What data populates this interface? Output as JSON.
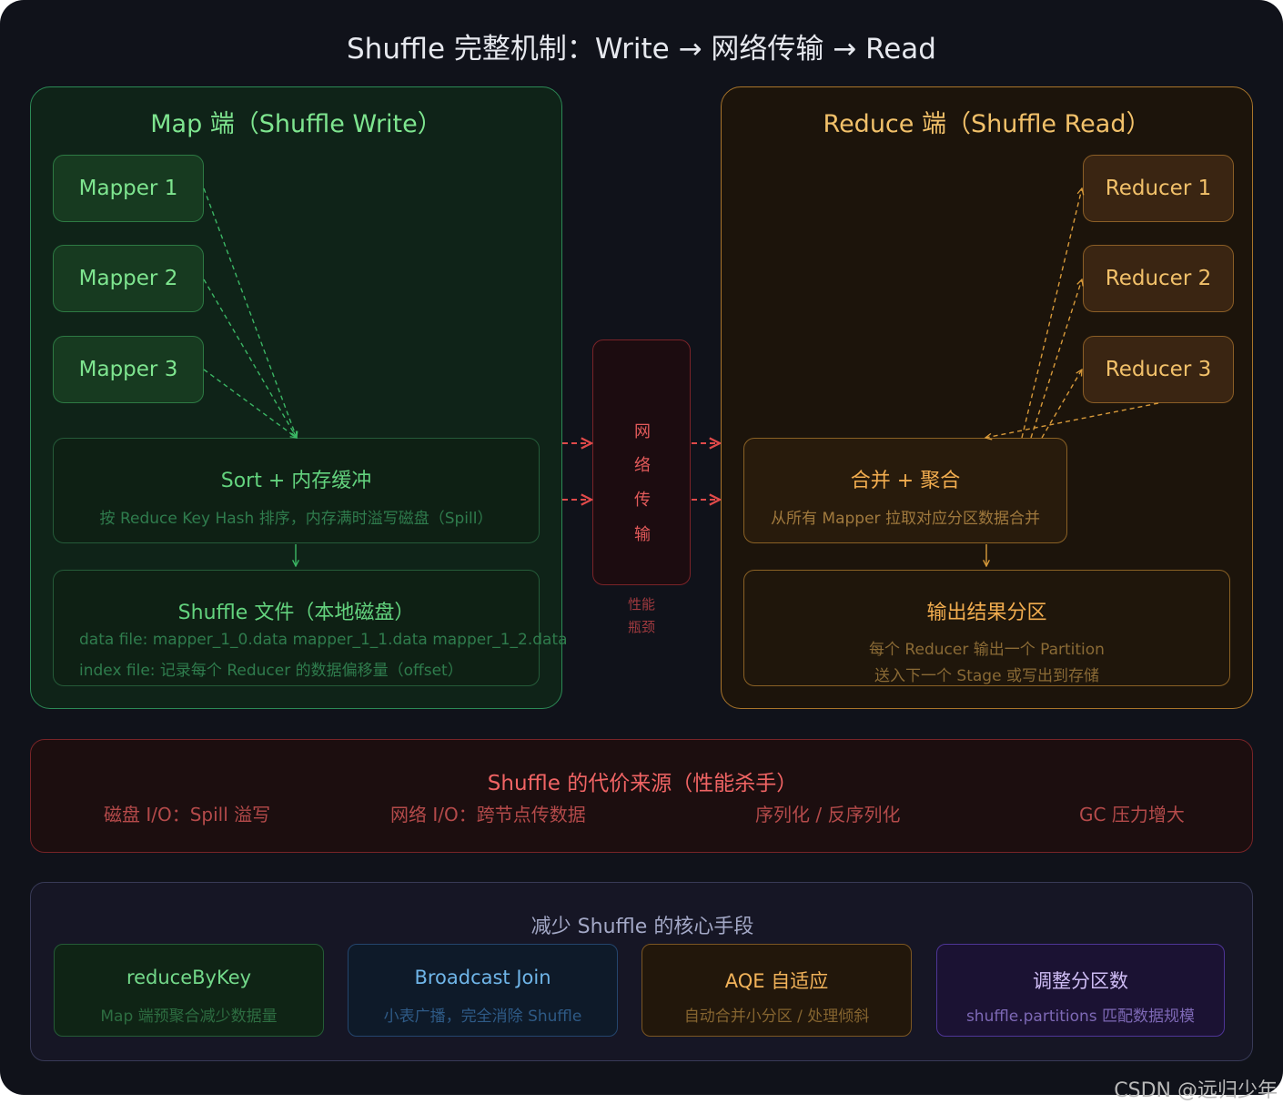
{
  "title": "Shuffle 完整机制：Write → 网络传输 → Read",
  "map_side": {
    "title": "Map 端（Shuffle Write）",
    "mappers": [
      "Mapper 1",
      "Mapper 2",
      "Mapper 3"
    ],
    "sort_box": {
      "title": "Sort + 内存缓冲",
      "desc": "按 Reduce Key Hash 排序，内存满时溢写磁盘（Spill）"
    },
    "file_box": {
      "title": "Shuffle 文件（本地磁盘）",
      "line1": "data file: mapper_1_0.data mapper_1_1.data mapper_1_2.data",
      "line2": "index file: 记录每个 Reducer 的数据偏移量（offset）"
    }
  },
  "network": {
    "chars": [
      "网",
      "络",
      "传",
      "输"
    ],
    "note_line1": "性能",
    "note_line2": "瓶颈"
  },
  "reduce_side": {
    "title": "Reduce 端（Shuffle Read）",
    "reducers": [
      "Reducer 1",
      "Reducer 2",
      "Reducer 3"
    ],
    "merge_box": {
      "title": "合并 + 聚合",
      "desc": "从所有 Mapper 拉取对应分区数据合并"
    },
    "output_box": {
      "title": "输出结果分区",
      "line1": "每个 Reducer 输出一个 Partition",
      "line2": "送入下一个 Stage 或写出到存储"
    }
  },
  "cost": {
    "title": "Shuffle 的代价来源（性能杀手）",
    "items": [
      "磁盘 I/O：Spill 溢写",
      "网络 I/O：跨节点传数据",
      "序列化 / 反序列化",
      "GC 压力增大"
    ]
  },
  "reduce_methods": {
    "title": "减少 Shuffle 的核心手段",
    "cards": [
      {
        "title": "reduceByKey",
        "desc": "Map 端预聚合减少数据量"
      },
      {
        "title": "Broadcast Join",
        "desc": "小表广播，完全消除 Shuffle"
      },
      {
        "title": "AQE 自适应",
        "desc": "自动合并小分区 / 处理倾斜"
      },
      {
        "title": "调整分区数",
        "desc": "shuffle.partitions 匹配数据规模"
      }
    ]
  },
  "watermark": "CSDN @远归少年",
  "colors": {
    "background": "#10121a",
    "map_green": "#7ee58f",
    "reduce_orange": "#f2c16a",
    "network_red": "#e25a5a",
    "method_blue": "#6fb5e8",
    "method_purple": "#cfbdf5"
  }
}
